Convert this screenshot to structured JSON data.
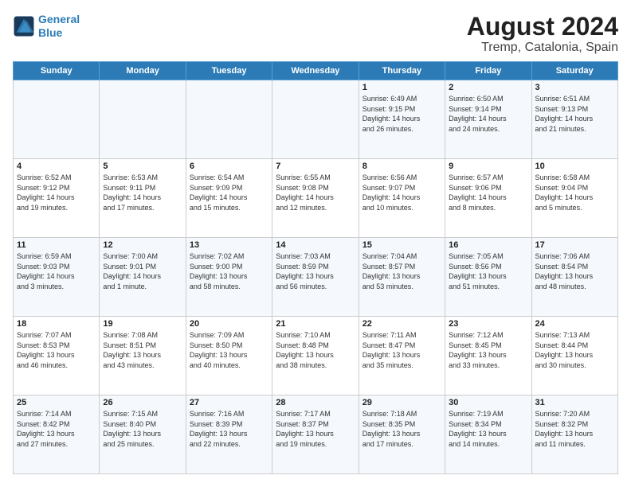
{
  "app": {
    "logo_line1": "General",
    "logo_line2": "Blue"
  },
  "title": "August 2024",
  "subtitle": "Tremp, Catalonia, Spain",
  "days_of_week": [
    "Sunday",
    "Monday",
    "Tuesday",
    "Wednesday",
    "Thursday",
    "Friday",
    "Saturday"
  ],
  "weeks": [
    [
      {
        "day": "",
        "info": ""
      },
      {
        "day": "",
        "info": ""
      },
      {
        "day": "",
        "info": ""
      },
      {
        "day": "",
        "info": ""
      },
      {
        "day": "1",
        "info": "Sunrise: 6:49 AM\nSunset: 9:15 PM\nDaylight: 14 hours\nand 26 minutes."
      },
      {
        "day": "2",
        "info": "Sunrise: 6:50 AM\nSunset: 9:14 PM\nDaylight: 14 hours\nand 24 minutes."
      },
      {
        "day": "3",
        "info": "Sunrise: 6:51 AM\nSunset: 9:13 PM\nDaylight: 14 hours\nand 21 minutes."
      }
    ],
    [
      {
        "day": "4",
        "info": "Sunrise: 6:52 AM\nSunset: 9:12 PM\nDaylight: 14 hours\nand 19 minutes."
      },
      {
        "day": "5",
        "info": "Sunrise: 6:53 AM\nSunset: 9:11 PM\nDaylight: 14 hours\nand 17 minutes."
      },
      {
        "day": "6",
        "info": "Sunrise: 6:54 AM\nSunset: 9:09 PM\nDaylight: 14 hours\nand 15 minutes."
      },
      {
        "day": "7",
        "info": "Sunrise: 6:55 AM\nSunset: 9:08 PM\nDaylight: 14 hours\nand 12 minutes."
      },
      {
        "day": "8",
        "info": "Sunrise: 6:56 AM\nSunset: 9:07 PM\nDaylight: 14 hours\nand 10 minutes."
      },
      {
        "day": "9",
        "info": "Sunrise: 6:57 AM\nSunset: 9:06 PM\nDaylight: 14 hours\nand 8 minutes."
      },
      {
        "day": "10",
        "info": "Sunrise: 6:58 AM\nSunset: 9:04 PM\nDaylight: 14 hours\nand 5 minutes."
      }
    ],
    [
      {
        "day": "11",
        "info": "Sunrise: 6:59 AM\nSunset: 9:03 PM\nDaylight: 14 hours\nand 3 minutes."
      },
      {
        "day": "12",
        "info": "Sunrise: 7:00 AM\nSunset: 9:01 PM\nDaylight: 14 hours\nand 1 minute."
      },
      {
        "day": "13",
        "info": "Sunrise: 7:02 AM\nSunset: 9:00 PM\nDaylight: 13 hours\nand 58 minutes."
      },
      {
        "day": "14",
        "info": "Sunrise: 7:03 AM\nSunset: 8:59 PM\nDaylight: 13 hours\nand 56 minutes."
      },
      {
        "day": "15",
        "info": "Sunrise: 7:04 AM\nSunset: 8:57 PM\nDaylight: 13 hours\nand 53 minutes."
      },
      {
        "day": "16",
        "info": "Sunrise: 7:05 AM\nSunset: 8:56 PM\nDaylight: 13 hours\nand 51 minutes."
      },
      {
        "day": "17",
        "info": "Sunrise: 7:06 AM\nSunset: 8:54 PM\nDaylight: 13 hours\nand 48 minutes."
      }
    ],
    [
      {
        "day": "18",
        "info": "Sunrise: 7:07 AM\nSunset: 8:53 PM\nDaylight: 13 hours\nand 46 minutes."
      },
      {
        "day": "19",
        "info": "Sunrise: 7:08 AM\nSunset: 8:51 PM\nDaylight: 13 hours\nand 43 minutes."
      },
      {
        "day": "20",
        "info": "Sunrise: 7:09 AM\nSunset: 8:50 PM\nDaylight: 13 hours\nand 40 minutes."
      },
      {
        "day": "21",
        "info": "Sunrise: 7:10 AM\nSunset: 8:48 PM\nDaylight: 13 hours\nand 38 minutes."
      },
      {
        "day": "22",
        "info": "Sunrise: 7:11 AM\nSunset: 8:47 PM\nDaylight: 13 hours\nand 35 minutes."
      },
      {
        "day": "23",
        "info": "Sunrise: 7:12 AM\nSunset: 8:45 PM\nDaylight: 13 hours\nand 33 minutes."
      },
      {
        "day": "24",
        "info": "Sunrise: 7:13 AM\nSunset: 8:44 PM\nDaylight: 13 hours\nand 30 minutes."
      }
    ],
    [
      {
        "day": "25",
        "info": "Sunrise: 7:14 AM\nSunset: 8:42 PM\nDaylight: 13 hours\nand 27 minutes."
      },
      {
        "day": "26",
        "info": "Sunrise: 7:15 AM\nSunset: 8:40 PM\nDaylight: 13 hours\nand 25 minutes."
      },
      {
        "day": "27",
        "info": "Sunrise: 7:16 AM\nSunset: 8:39 PM\nDaylight: 13 hours\nand 22 minutes."
      },
      {
        "day": "28",
        "info": "Sunrise: 7:17 AM\nSunset: 8:37 PM\nDaylight: 13 hours\nand 19 minutes."
      },
      {
        "day": "29",
        "info": "Sunrise: 7:18 AM\nSunset: 8:35 PM\nDaylight: 13 hours\nand 17 minutes."
      },
      {
        "day": "30",
        "info": "Sunrise: 7:19 AM\nSunset: 8:34 PM\nDaylight: 13 hours\nand 14 minutes."
      },
      {
        "day": "31",
        "info": "Sunrise: 7:20 AM\nSunset: 8:32 PM\nDaylight: 13 hours\nand 11 minutes."
      }
    ]
  ]
}
